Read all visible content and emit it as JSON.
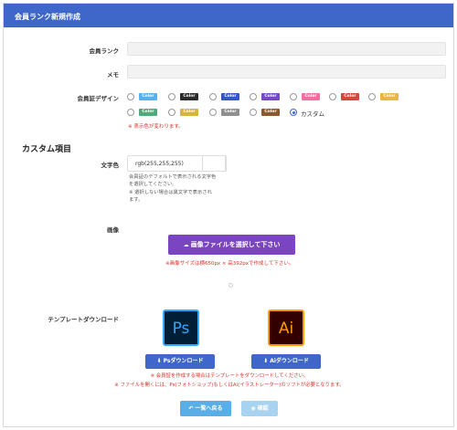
{
  "header": {
    "title": "会員ランク新規作成"
  },
  "fields": {
    "rank_label": "会員ランク",
    "memo_label": "メモ",
    "design_label": "会員証デザイン",
    "design_warning": "※ 表示色が変わります。",
    "custom_option_label": "カスタム"
  },
  "chips": [
    {
      "label": "Color",
      "color": "#5ab0e8"
    },
    {
      "label": "Color",
      "color": "#2a2a2a"
    },
    {
      "label": "Color",
      "color": "#3557c2"
    },
    {
      "label": "Color",
      "color": "#7548c4"
    },
    {
      "label": "Color",
      "color": "#ee6fa0"
    },
    {
      "label": "Color",
      "color": "#cf4a3c"
    },
    {
      "label": "Color",
      "color": "#e8b646"
    },
    {
      "label": "Color",
      "color": "#53a97c"
    },
    {
      "label": "Color",
      "color": "#d7b43a"
    },
    {
      "label": "Color",
      "color": "#8f8f8f"
    },
    {
      "label": "Color",
      "color": "#8a5a2e"
    }
  ],
  "custom": {
    "section_title": "カスタム項目",
    "text_color_label": "文字色",
    "text_color_value": "rgb(255,255,255)",
    "help_line1": "会員証のデフォルトで表示される文字色",
    "help_line2": "を選択してください。",
    "help_line3": "※ 選択しない場合は黒文字で表示され",
    "help_line4": "ます。"
  },
  "image": {
    "label": "画像",
    "upload_button": "画像ファイルを選択して下さい",
    "size_note": "※画像サイズは横650px × 高392pxで作成して下さい。"
  },
  "template": {
    "label": "テンプレートダウンロード",
    "ps_icon_text": "Ps",
    "ai_icon_text": "Ai",
    "ps_button": "Psダウンロード",
    "ai_button": "Aiダウンロード",
    "note1": "※ 会員証を作成する場合はテンプレートをダウンロードしてください。",
    "note2": "※ ファイルを開くには、Ps(フォトショップ)もしくはAi(イラストレーター)のソフトが必要となります。"
  },
  "footer": {
    "back_button": "一覧へ戻る",
    "confirm_button": "確認"
  }
}
